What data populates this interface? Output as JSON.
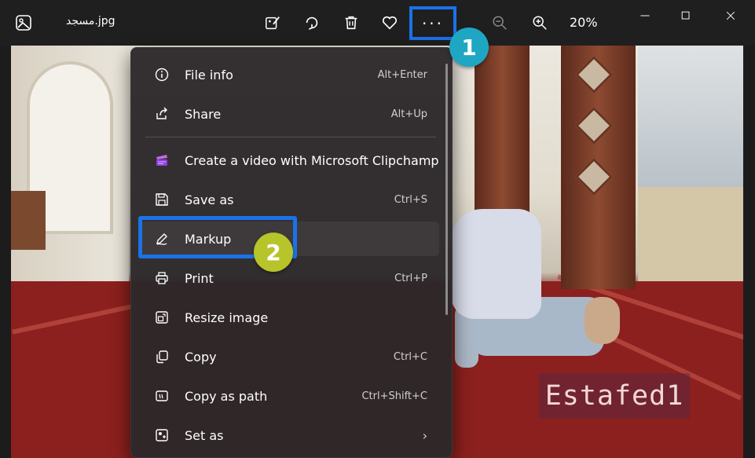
{
  "window": {
    "file_name": "مسجد.jpg",
    "zoom_level": "20%"
  },
  "toolbar": {
    "icons": [
      "edit-image-icon",
      "rotate-icon",
      "delete-icon",
      "favorite-icon",
      "more-options-icon",
      "zoom-out-icon",
      "zoom-in-icon"
    ],
    "more_label": "···"
  },
  "menu": {
    "items": [
      {
        "label": "File info",
        "shortcut": "Alt+Enter",
        "icon": "info-icon"
      },
      {
        "label": "Share",
        "shortcut": "Alt+Up",
        "icon": "share-icon"
      },
      {
        "label": "Create a video with Microsoft Clipchamp",
        "shortcut": "",
        "icon": "clipchamp-icon"
      },
      {
        "label": "Save as",
        "shortcut": "Ctrl+S",
        "icon": "save-icon"
      },
      {
        "label": "Markup",
        "shortcut": "",
        "icon": "markup-pen-icon"
      },
      {
        "label": "Print",
        "shortcut": "Ctrl+P",
        "icon": "print-icon"
      },
      {
        "label": "Resize image",
        "shortcut": "",
        "icon": "resize-icon"
      },
      {
        "label": "Copy",
        "shortcut": "Ctrl+C",
        "icon": "copy-icon"
      },
      {
        "label": "Copy as path",
        "shortcut": "Ctrl+Shift+C",
        "icon": "copy-path-icon"
      },
      {
        "label": "Set as",
        "shortcut": "",
        "icon": "set-as-icon"
      }
    ]
  },
  "annotations": {
    "step_1": "1",
    "step_2": "2",
    "watermark": "Estafed1",
    "highlight_color": "#1a73e8"
  }
}
